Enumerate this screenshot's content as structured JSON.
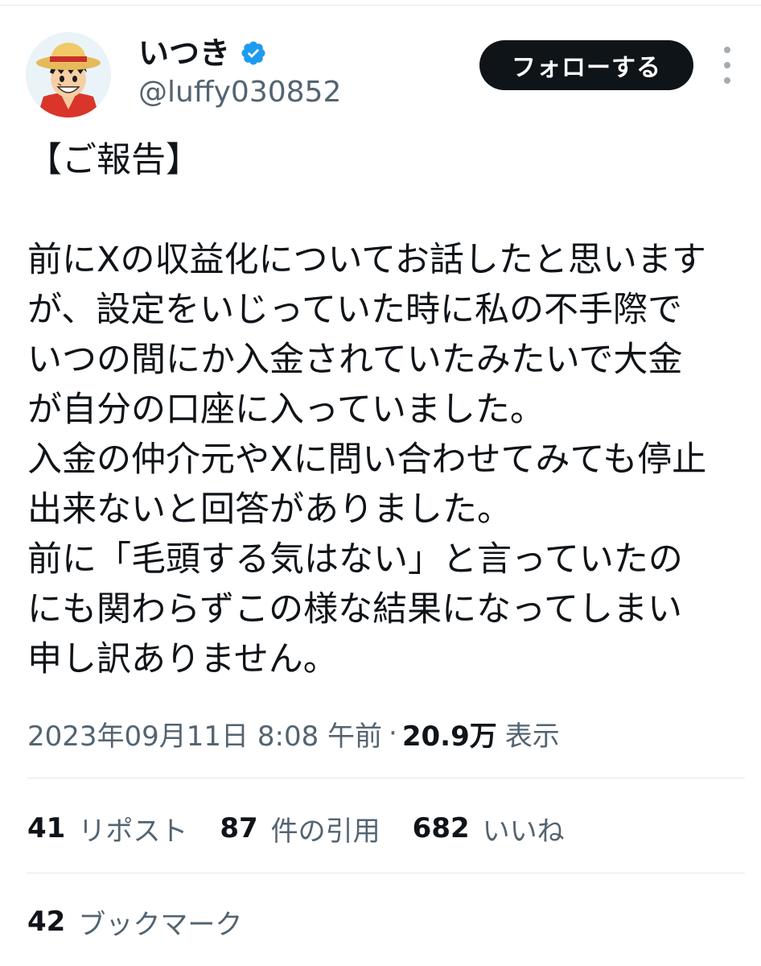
{
  "author": {
    "display_name": "いつき",
    "handle": "@luffy030852",
    "verified_icon": "verified-badge-icon",
    "avatar_icon": "avatar-straw-hat-character"
  },
  "follow_button_label": "フォローする",
  "tweet": {
    "lines": [
      "【ご報告】",
      "",
      "前にXの収益化についてお話したと思います",
      "が、設定をいじっていた時に私の不手際で",
      "いつの間にか入金されていたみたいで大金",
      "が自分の口座に入っていました。",
      "入金の仲介元やXに問い合わせてみても停止",
      "出来ないと回答がありました。",
      "前に「毛頭する気はない」と言っていたの",
      "にも関わらずこの様な結果になってしまい",
      "申し訳ありません。"
    ]
  },
  "meta": {
    "timestamp": "2023年09月11日 8:08 午前",
    "separator": "·",
    "views_count": "20.9万",
    "views_label": "表示"
  },
  "stats": {
    "reposts": {
      "count": "41",
      "label": "リポスト"
    },
    "quotes": {
      "count": "87",
      "label": "件の引用"
    },
    "likes": {
      "count": "682",
      "label": "いいね"
    },
    "bookmarks": {
      "count": "42",
      "label": "ブックマーク"
    }
  },
  "colors": {
    "text_primary": "#0f1419",
    "text_secondary": "#536471",
    "verified_blue": "#1d9bf0",
    "follow_button_bg": "#0f1419",
    "divider": "#e6e9ec"
  }
}
